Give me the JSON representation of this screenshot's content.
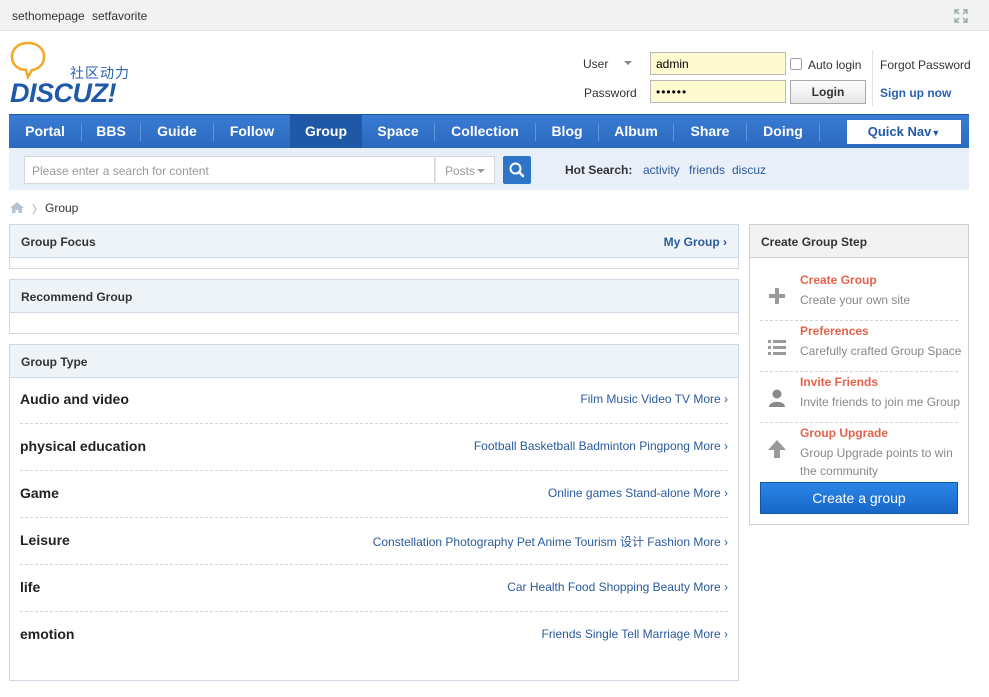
{
  "topbar": {
    "sethomepage": "sethomepage",
    "setfavorite": "setfavorite"
  },
  "logo": {
    "text": "DISCUZ!",
    "cn": "社区动力"
  },
  "login": {
    "user_label": "User",
    "user_value": "admin",
    "password_label": "Password",
    "password_value": "••••••",
    "auto_login": "Auto login",
    "login_btn": "Login",
    "forgot": "Forgot Password",
    "signup": "Sign up now"
  },
  "nav": {
    "items": [
      "Portal",
      "BBS",
      "Guide",
      "Follow",
      "Group",
      "Space",
      "Collection",
      "Blog",
      "Album",
      "Share",
      "Doing"
    ],
    "active": "Group",
    "quick_nav": "Quick Nav"
  },
  "search": {
    "placeholder": "Please enter a search for content",
    "type": "Posts",
    "hot_label": "Hot Search:",
    "hot": [
      "activity",
      "friends",
      "discuz"
    ]
  },
  "breadcrumb": {
    "current": "Group"
  },
  "group_focus": {
    "title": "Group Focus",
    "my_group": "My Group ›"
  },
  "recommend": {
    "title": "Recommend Group"
  },
  "group_type": {
    "title": "Group Type",
    "rows": [
      {
        "name": "Audio and video",
        "links": "Film Music Video TV More ›"
      },
      {
        "name": "physical education",
        "links": "Football Basketball Badminton Pingpong More ›"
      },
      {
        "name": "Game",
        "links": "Online games Stand-alone More ›"
      },
      {
        "name": "Leisure",
        "links": "Constellation Photography Pet Anime Tourism 设计 Fashion More ›"
      },
      {
        "name": "life",
        "links": "Car Health Food Shopping Beauty More ›"
      },
      {
        "name": "emotion",
        "links": "Friends Single Tell Marriage More ›"
      }
    ]
  },
  "create_steps": {
    "title": "Create Group Step",
    "steps": [
      {
        "title": "Create Group",
        "desc": "Create your own site",
        "icon": "plus-icon"
      },
      {
        "title": "Preferences",
        "desc": "Carefully crafted Group Space",
        "icon": "list-icon"
      },
      {
        "title": "Invite Friends",
        "desc": "Invite friends to join me Group",
        "icon": "user-icon"
      },
      {
        "title": "Group Upgrade",
        "desc": "Group Upgrade points to win the community",
        "icon": "arrow-up-icon"
      }
    ],
    "button": "Create a group"
  },
  "colors": {
    "nav_blue": "#2b69bf",
    "step_title": "#e4634a",
    "link": "#2a5a9c"
  }
}
